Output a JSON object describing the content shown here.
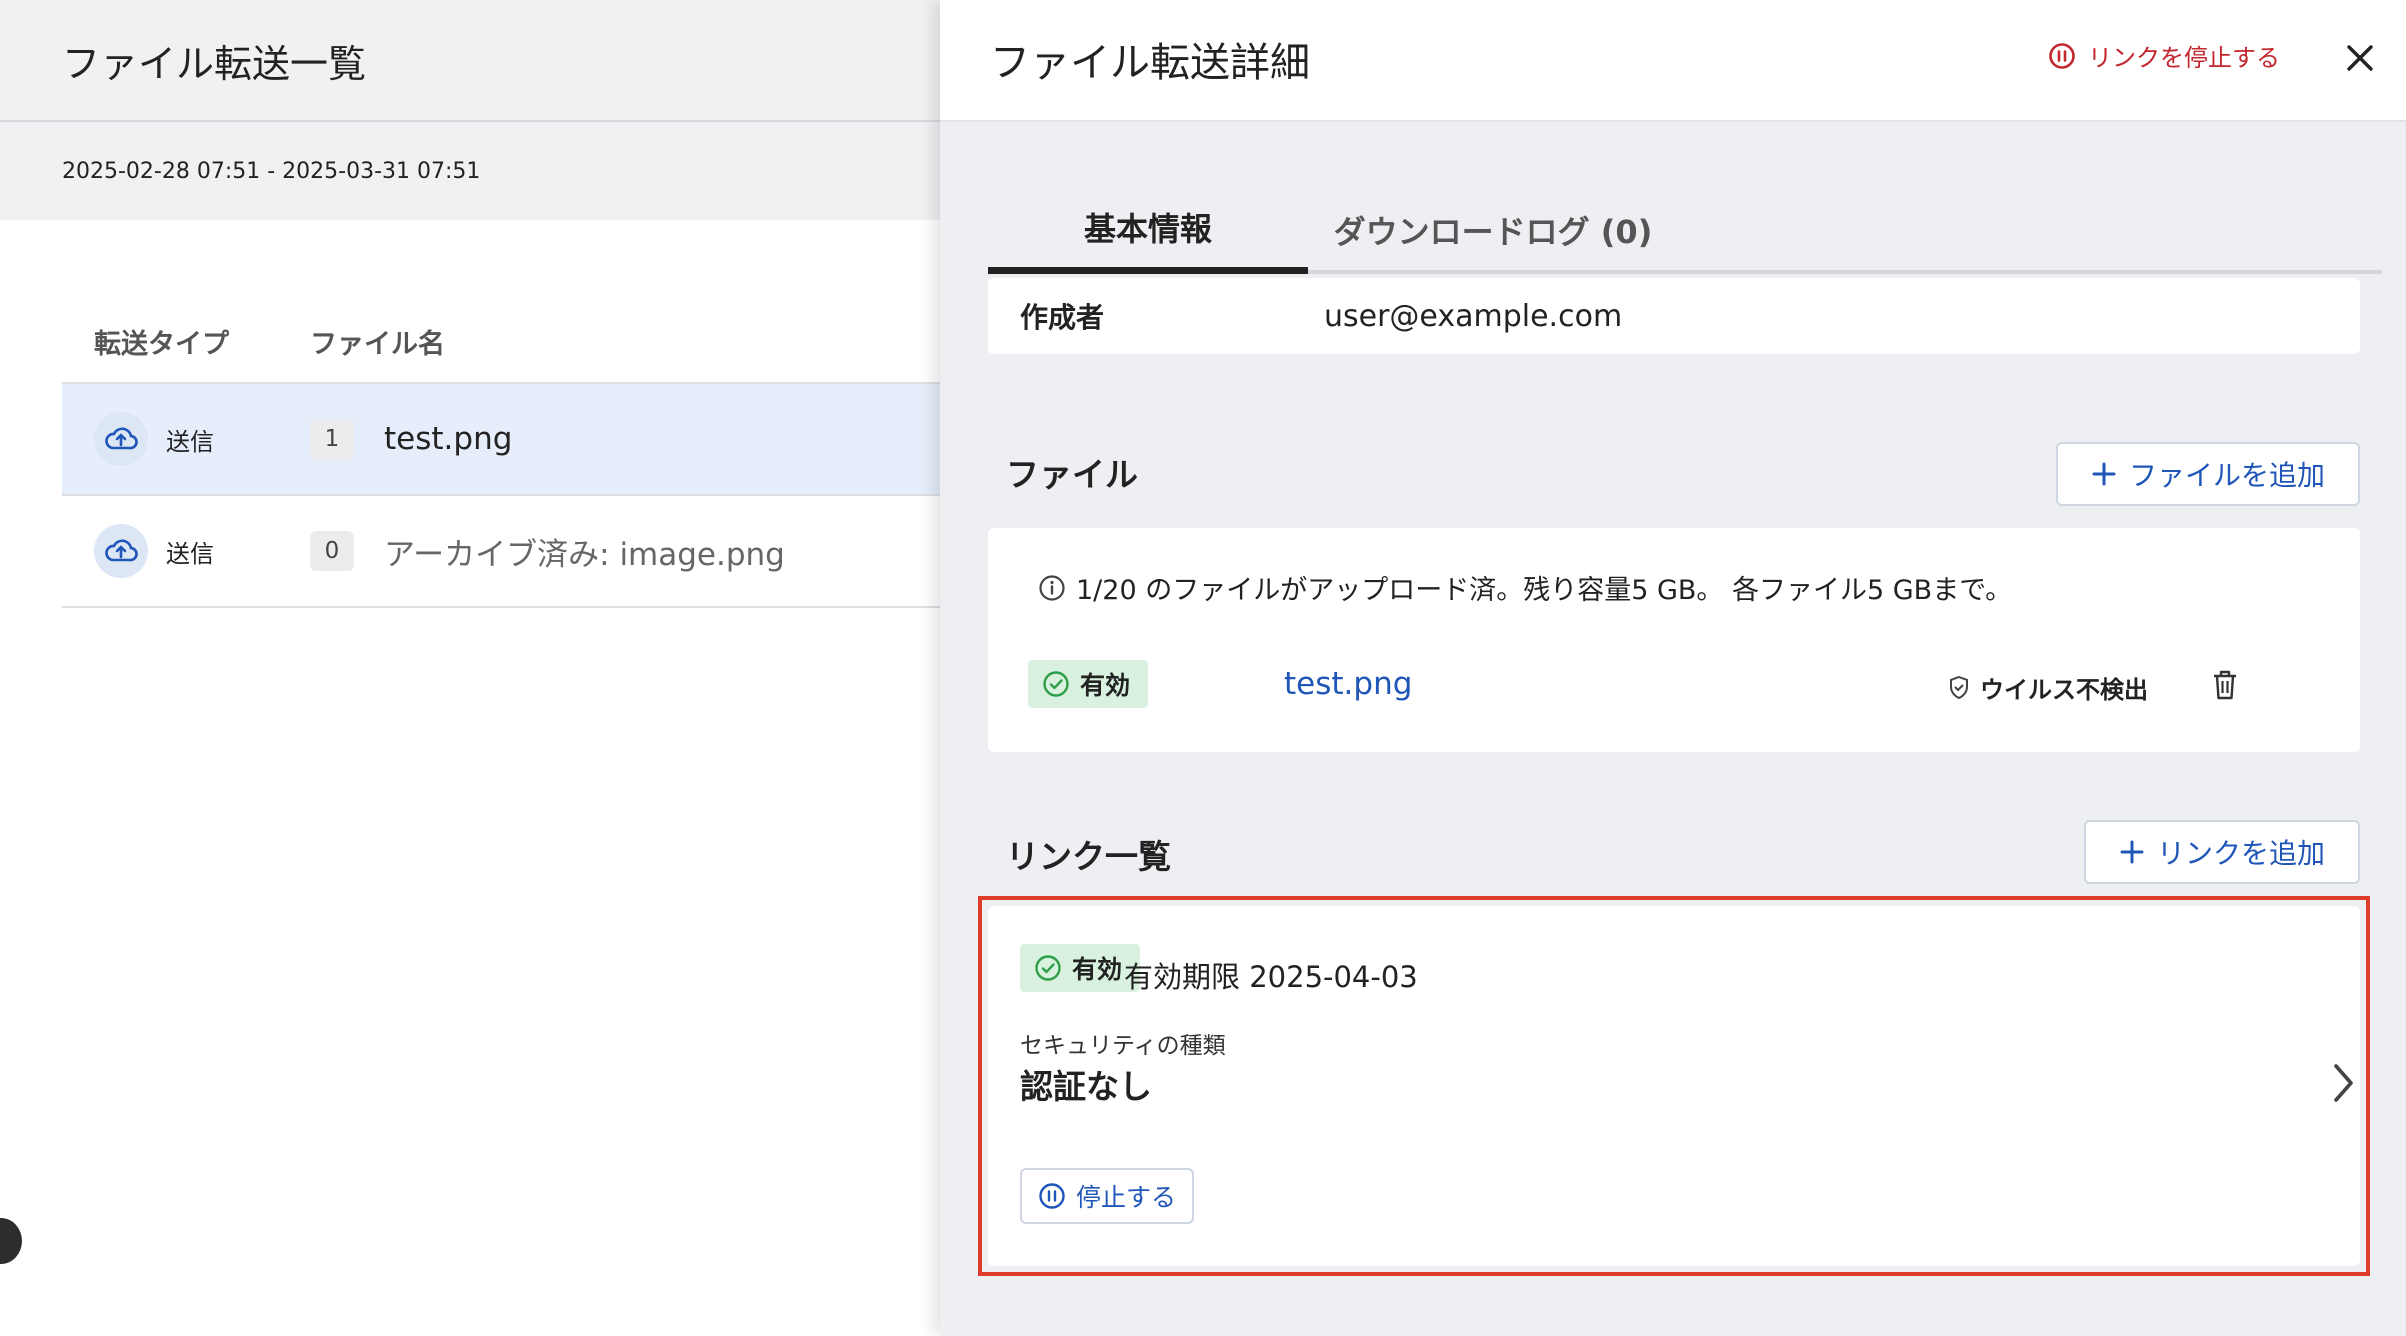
{
  "left": {
    "title": "ファイル転送一覧",
    "date_range": "2025-02-28 07:51 - 2025-03-31 07:51",
    "columns": {
      "type": "転送タイプ",
      "name": "ファイル名"
    },
    "rows": [
      {
        "type": "送信",
        "count": "1",
        "name": "test.png",
        "selected": true
      },
      {
        "type": "送信",
        "count": "0",
        "name": "アーカイブ済み: image.png",
        "selected": false
      }
    ]
  },
  "detail": {
    "title": "ファイル転送詳細",
    "stop_link_label": "リンクを停止する",
    "tabs": [
      {
        "label": "基本情報",
        "active": true
      },
      {
        "label": "ダウンロードログ (0)",
        "active": false
      }
    ],
    "author": {
      "label": "作成者",
      "value": "user@example.com"
    },
    "files": {
      "title": "ファイル",
      "add_label": "ファイルを追加",
      "info": "1/20 のファイルがアップロード済。残り容量5 GB。 各ファイル5 GBまで。",
      "items": [
        {
          "status": "有効",
          "name": "test.png",
          "scan": "ウイルス不検出"
        }
      ]
    },
    "links": {
      "title": "リンク一覧",
      "add_label": "リンクを追加",
      "items": [
        {
          "status": "有効",
          "expiry": "有効期限 2025-04-03",
          "security_label": "セキュリティの種類",
          "security_value": "認証なし",
          "pause_label": "停止する"
        }
      ]
    }
  },
  "colors": {
    "accent_blue": "#1f56b8",
    "danger_red": "#c4262e",
    "highlight_outline": "#e03b2a",
    "status_green_bg": "#d9f2df",
    "status_green_icon": "#2e9e4a",
    "selected_row_bg": "#e6eefb"
  }
}
